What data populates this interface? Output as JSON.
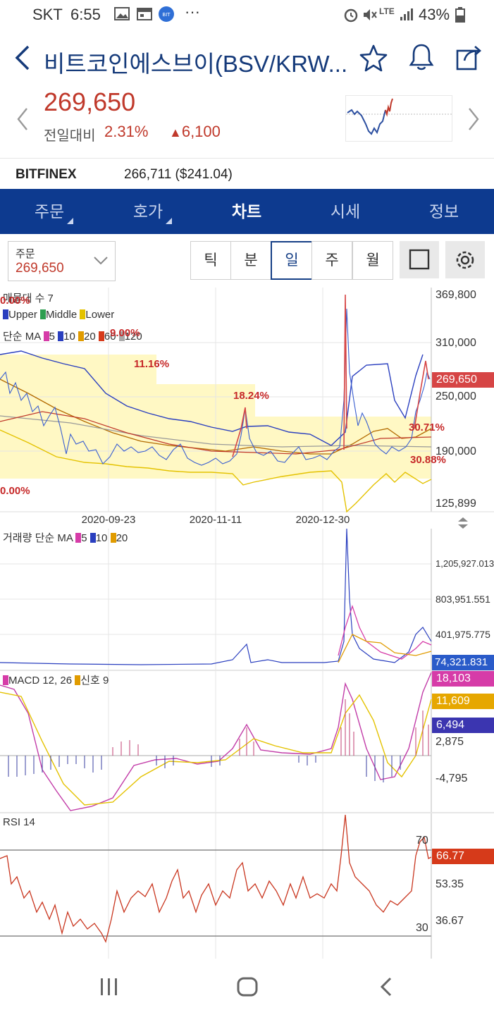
{
  "status": {
    "carrier": "SKT",
    "time": "6:55",
    "more": "···",
    "network": "LTE",
    "battery": "43%"
  },
  "header": {
    "title": "비트코인에스브이(BSV/KRW..."
  },
  "quote": {
    "price": "269,650",
    "change_label": "전일대비",
    "change_pct": "2.31%",
    "change_amount": "6,100",
    "up_color": "#c0392b"
  },
  "exchange": {
    "name": "BITFINEX",
    "value": "266,711 ($241.04)"
  },
  "tabs": [
    {
      "label": "주문"
    },
    {
      "label": "호가"
    },
    {
      "label": "차트"
    },
    {
      "label": "시세"
    },
    {
      "label": "정보"
    }
  ],
  "order": {
    "label": "주문",
    "value": "269,650"
  },
  "periods": [
    "틱",
    "분",
    "일",
    "주",
    "월"
  ],
  "selected_period": "일",
  "chart_data": [
    {
      "type": "line",
      "title": "",
      "legend": {
        "volume_profile": "매물대 수 7",
        "bollinger": [
          "Upper",
          "Middle",
          "Lower"
        ],
        "ma_label": "단순 MA",
        "ma_periods": [
          "5",
          "10",
          "20",
          "60",
          "120"
        ]
      },
      "x_ticks": [
        "2020-09-23",
        "2020-11-11",
        "2020-12-30"
      ],
      "y_ticks": [
        "369,800",
        "310,000",
        "250,000",
        "190,000",
        "125,899"
      ],
      "ylim": [
        125899,
        369800
      ],
      "last_price": "269,650",
      "volume_profile_pcts": [
        "0.00%",
        "11.16%",
        "9.00%",
        "18.24%",
        "30.71%",
        "30.88%",
        "0.00%"
      ]
    },
    {
      "type": "bar",
      "title": "거래량 단순 MA",
      "ma_periods": [
        "5",
        "10",
        "20"
      ],
      "y_ticks": [
        "1,205,927.013",
        "803,951.551",
        "401,975.775"
      ],
      "last_value": "74,321.831"
    },
    {
      "type": "line",
      "title": "MACD 12, 26",
      "signal_label": "신호 9",
      "y_ticks": [
        "2,875",
        "-4,795"
      ],
      "badges": {
        "macd": "18,103",
        "signal": "11,609",
        "histogram": "6,494"
      }
    },
    {
      "type": "line",
      "title": "RSI 14",
      "y_ticks": [
        "70",
        "53.35",
        "36.67",
        "30"
      ],
      "last_value": "66.77"
    }
  ]
}
